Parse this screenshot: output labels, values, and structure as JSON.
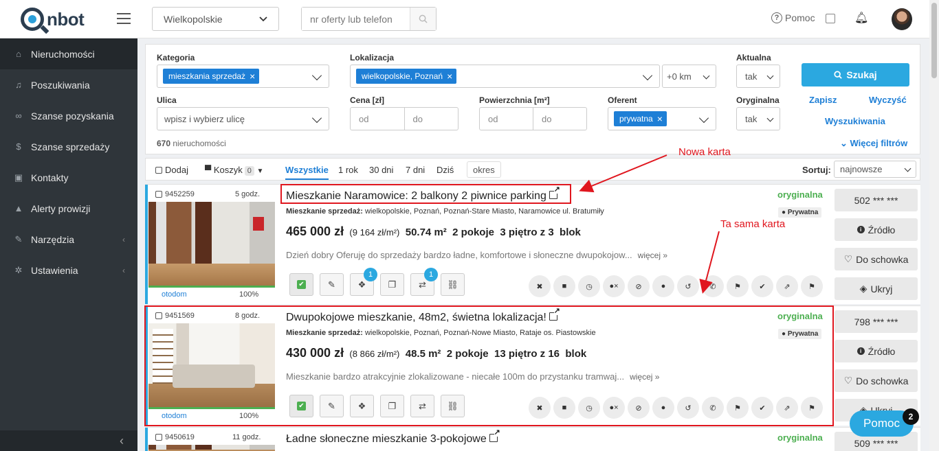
{
  "header": {
    "logo_text": "nbot",
    "region": "Wielkopolskie",
    "search_placeholder": "nr oferty lub telefon",
    "help_label": "Pomoc"
  },
  "sidebar": {
    "items": [
      {
        "label": "Nieruchomości",
        "icon": "home-icon"
      },
      {
        "label": "Poszukiwania",
        "icon": "bell-icon"
      },
      {
        "label": "Szanse pozyskania",
        "icon": "handshake-icon"
      },
      {
        "label": "Szanse sprzedaży",
        "icon": "dollar-icon"
      },
      {
        "label": "Kontakty",
        "icon": "contact-icon"
      },
      {
        "label": "Alerty prowizji",
        "icon": "warning-icon"
      },
      {
        "label": "Narzędzia",
        "icon": "wrench-icon"
      },
      {
        "label": "Ustawienia",
        "icon": "gear-icon"
      }
    ]
  },
  "filters": {
    "kategoria_label": "Kategoria",
    "kategoria_tag": "mieszkania sprzedaż",
    "lokalizacja_label": "Lokalizacja",
    "lokalizacja_tag": "wielkopolskie, Poznań",
    "radius": "+0 km",
    "aktualna_label": "Aktualna",
    "aktualna_value": "tak",
    "search_button": "Szukaj",
    "ulica_label": "Ulica",
    "ulica_placeholder": "wpisz i wybierz ulicę",
    "cena_label": "Cena [zł]",
    "cena_from": "od",
    "cena_to": "do",
    "powierzchnia_label": "Powierzchnia [m²]",
    "pow_from": "od",
    "pow_to": "do",
    "oferent_label": "Oferent",
    "oferent_tag": "prywatna",
    "oryginalna_label": "Oryginalna",
    "oryginalna_value": "tak",
    "zapisz": "Zapisz",
    "wyczysc": "Wyczyść",
    "wyszukiwania": "Wyszukiwania",
    "wiecej_filtrow": "Więcej filtrów",
    "count_number": "670",
    "count_label": "nieruchomości"
  },
  "tabs": {
    "dodaj": "Dodaj",
    "koszyk": "Koszyk",
    "koszyk_count": "0",
    "items": [
      "Wszystkie",
      "1 rok",
      "30 dni",
      "7 dni",
      "Dziś"
    ],
    "okres": "okres",
    "sort_label": "Sortuj:",
    "sort_value": "najnowsze"
  },
  "listings": [
    {
      "id": "9452259",
      "age": "5 godz.",
      "title": "Mieszkanie Naramowice: 2 balkony 2 piwnice parking",
      "type": "Mieszkanie sprzedaż:",
      "location": "wielkopolskie, Poznań, Poznań-Stare Miasto, Naramowice ul. Bratumiły",
      "price": "465 000 zł",
      "price_sqm": "(9 164 zł/m²)",
      "area": "50.74 m²",
      "rooms": "2 pokoje",
      "floor": "3 piętro z 3",
      "building": "blok",
      "description": "Dzień dobry Oferuję do sprzedaży bardzo ładne, komfortowe i słoneczne dwupokojow...",
      "more": "więcej »",
      "original": "oryginalna",
      "offerer": "Prywatna",
      "source": "otodom",
      "percent": "100%",
      "phone": "502 *** ***",
      "badge_a": "1",
      "badge_b": "1"
    },
    {
      "id": "9451569",
      "age": "8 godz.",
      "title": "Dwupokojowe mieszkanie, 48m2, świetna lokalizacja!",
      "type": "Mieszkanie sprzedaż:",
      "location": "wielkopolskie, Poznań, Poznań-Nowe Miasto, Rataje os. Piastowskie",
      "price": "430 000 zł",
      "price_sqm": "(8 866 zł/m²)",
      "area": "48.5 m²",
      "rooms": "2 pokoje",
      "floor": "13 piętro z 16",
      "building": "blok",
      "description": "Mieszkanie bardzo atrakcyjnie zlokalizowane - niecałe 100m do przystanku tramwaj...",
      "more": "więcej »",
      "original": "oryginalna",
      "offerer": "Prywatna",
      "source": "otodom",
      "percent": "100%",
      "phone": "798 *** ***"
    },
    {
      "id": "9450619",
      "age": "11 godz.",
      "title": "Ładne słoneczne mieszkanie 3-pokojowe",
      "original": "oryginalna",
      "phone": "509 *** ***"
    }
  ],
  "right_buttons": {
    "zrodlo": "Źródło",
    "schowek": "Do schowka",
    "ukryj": "Ukryj"
  },
  "annotations": {
    "nowa_karta": "Nowa karta",
    "ta_sama_karta": "Ta sama karta"
  },
  "chat": {
    "label": "Pomoc",
    "badge": "2"
  },
  "colors": {
    "accent": "#2ba8e0",
    "tag_blue": "#1e7fd6",
    "sidebar_bg": "#2f353a",
    "green": "#4caf50",
    "annotation_red": "#e0161e"
  }
}
